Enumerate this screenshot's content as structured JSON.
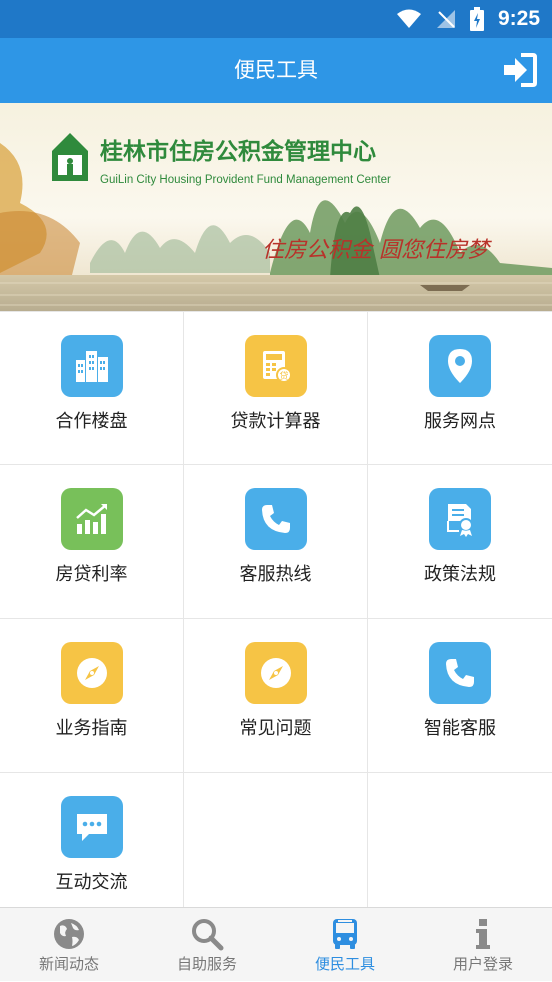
{
  "status_bar": {
    "time": "9:25"
  },
  "header": {
    "title": "便民工具"
  },
  "banner": {
    "org_name": "桂林市住房公积金管理中心",
    "org_name_en": "GuiLin City Housing Provident Fund Management Center",
    "slogan": "住房公积金 圆您住房梦"
  },
  "tools": [
    {
      "label": "合作楼盘",
      "icon": "buildings-icon",
      "color": "#4aaee9"
    },
    {
      "label": "贷款计算器",
      "icon": "calculator-icon",
      "color": "#f6c445"
    },
    {
      "label": "服务网点",
      "icon": "location-pin-icon",
      "color": "#4aaee9"
    },
    {
      "label": "房贷利率",
      "icon": "trend-chart-icon",
      "color": "#78c05a"
    },
    {
      "label": "客服热线",
      "icon": "phone-icon",
      "color": "#4aaee9"
    },
    {
      "label": "政策法规",
      "icon": "certificate-icon",
      "color": "#4aaee9"
    },
    {
      "label": "业务指南",
      "icon": "compass-icon",
      "color": "#f6c445"
    },
    {
      "label": "常见问题",
      "icon": "compass-icon",
      "color": "#f6c445"
    },
    {
      "label": "智能客服",
      "icon": "phone-icon",
      "color": "#4aaee9"
    },
    {
      "label": "互动交流",
      "icon": "chat-bubble-icon",
      "color": "#4aaee9"
    }
  ],
  "tabs": [
    {
      "label": "新闻动态",
      "icon": "globe-icon"
    },
    {
      "label": "自助服务",
      "icon": "search-icon"
    },
    {
      "label": "便民工具",
      "icon": "bus-icon",
      "active": true
    },
    {
      "label": "用户登录",
      "icon": "info-icon"
    }
  ]
}
